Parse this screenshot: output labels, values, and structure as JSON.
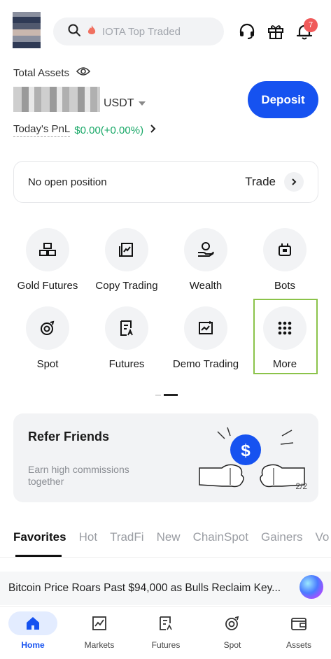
{
  "header": {
    "search_placeholder": "IOTA Top Traded",
    "notification_count": "7"
  },
  "assets": {
    "label": "Total Assets",
    "currency": "USDT",
    "pnl_label": "Today's PnL",
    "pnl_value": "$0.00(+0.00%)",
    "deposit_label": "Deposit"
  },
  "position": {
    "text": "No open position",
    "trade_label": "Trade"
  },
  "shortcuts": [
    {
      "label": "Gold Futures",
      "icon": "gold-bars-icon"
    },
    {
      "label": "Copy Trading",
      "icon": "copy-trading-icon"
    },
    {
      "label": "Wealth",
      "icon": "wealth-icon"
    },
    {
      "label": "Bots",
      "icon": "bot-icon"
    },
    {
      "label": "Spot",
      "icon": "spot-icon"
    },
    {
      "label": "Futures",
      "icon": "futures-icon"
    },
    {
      "label": "Demo Trading",
      "icon": "demo-trading-icon"
    },
    {
      "label": "More",
      "icon": "more-grid-icon"
    }
  ],
  "refer": {
    "title": "Refer Friends",
    "subtitle": "Earn high commissions together",
    "pager": "2/2"
  },
  "market_tabs": [
    "Favorites",
    "Hot",
    "TradFi",
    "New",
    "ChainSpot",
    "Gainers",
    "Vo"
  ],
  "news": {
    "headline": "Bitcoin Price Roars Past $94,000 as Bulls Reclaim Key..."
  },
  "nav": [
    {
      "label": "Home",
      "icon": "home-icon",
      "active": true
    },
    {
      "label": "Markets",
      "icon": "markets-icon"
    },
    {
      "label": "Futures",
      "icon": "futures-icon"
    },
    {
      "label": "Spot",
      "icon": "spot-icon"
    },
    {
      "label": "Assets",
      "icon": "wallet-icon"
    }
  ],
  "colors": {
    "accent": "#1652f0",
    "positive": "#18a867",
    "badge": "#f05a5a",
    "highlight_box": "#8bc34a"
  }
}
